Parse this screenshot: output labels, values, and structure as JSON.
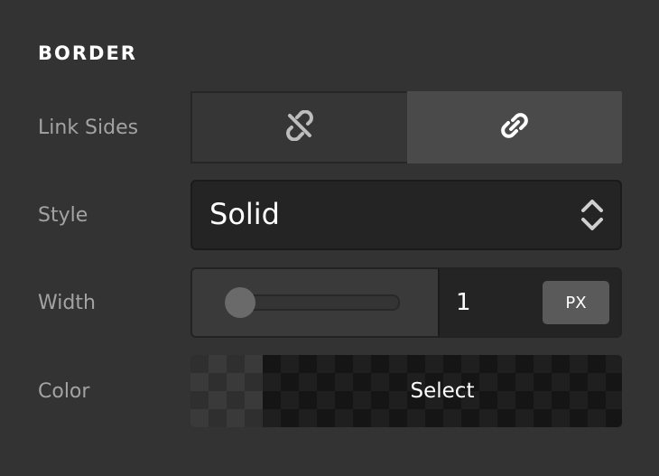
{
  "section": {
    "title": "BORDER"
  },
  "link_sides": {
    "label": "Link Sides",
    "options": [
      {
        "icon": "unlink-icon",
        "selected": false
      },
      {
        "icon": "link-icon",
        "selected": true
      }
    ]
  },
  "style": {
    "label": "Style",
    "value": "Solid",
    "icon": "up-down-arrows-icon"
  },
  "width": {
    "label": "Width",
    "value": "1",
    "unit": "PX",
    "slider_value": 0
  },
  "color": {
    "label": "Color",
    "button_label": "Select"
  },
  "colors": {
    "background": "#333333",
    "text": "#ffffff",
    "label": "#a3a3a3",
    "field": "#242424",
    "active_segment": "#4a4a4a"
  }
}
